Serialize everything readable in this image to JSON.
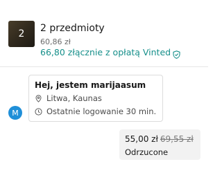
{
  "item": {
    "count": "2",
    "title": "2 przedmioty",
    "price": "60,86 zł",
    "fee_text": "66,80 złącznie z opłatą Vinted",
    "thumbnail_icon": "item-thumbnail",
    "fee_icon": "shield-check-icon"
  },
  "profile": {
    "greeting": "Hej, jestem marijaasum",
    "location": "Litwa, Kaunas",
    "last_login": "Ostatnie logowanie 30 min.",
    "location_icon": "location-pin-icon",
    "clock_icon": "clock-icon"
  },
  "avatar": {
    "initial": "M",
    "color": "#1f8fd8"
  },
  "offer": {
    "new_price": "55,00 zł",
    "old_price": "69,55 zł",
    "status": "Odrzucone"
  },
  "colors": {
    "accent": "#168f8a",
    "avatar": "#1f8fd8"
  }
}
